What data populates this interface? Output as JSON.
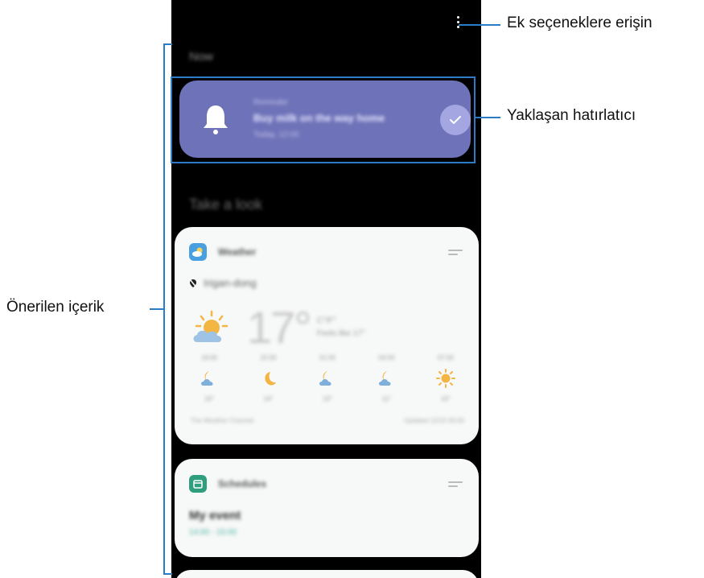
{
  "callouts": {
    "more_options": "Ek seçeneklere erişin",
    "upcoming_reminder": "Yaklaşan hatırlatıcı",
    "suggested_content": "Önerilen içerik"
  },
  "screen": {
    "section_now": "Now",
    "section_take_a_look": "Take a look",
    "reminder": {
      "label": "Reminder",
      "title": "Buy milk on the way home",
      "time": "Today, 12:00"
    },
    "weather": {
      "app_name": "Weather",
      "location": "Irigan-dong",
      "temperature": "17°",
      "temp_unit": "C°/F°",
      "feels_like": "Feels like 17°",
      "forecast": [
        {
          "time": "19:00",
          "icon": "moon-cloud-icon",
          "temp": "16°"
        },
        {
          "time": "22:00",
          "icon": "moon-icon",
          "temp": "14°"
        },
        {
          "time": "01:00",
          "icon": "moon-cloud-icon",
          "temp": "13°"
        },
        {
          "time": "04:00",
          "icon": "moon-cloud-icon",
          "temp": "11°"
        },
        {
          "time": "07:00",
          "icon": "sun-icon",
          "temp": "10°"
        }
      ],
      "source": "The Weather Channel",
      "updated": "Updated 12/10 00:00"
    },
    "schedule": {
      "app_name": "Schedules",
      "event_title": "My event",
      "event_time": "14:00 - 15:00"
    }
  },
  "colors": {
    "callout_blue": "#2b7bc6",
    "reminder_card": "#6e72b8",
    "phone_bg": "#000000",
    "card_bg": "#f7f8f8"
  }
}
